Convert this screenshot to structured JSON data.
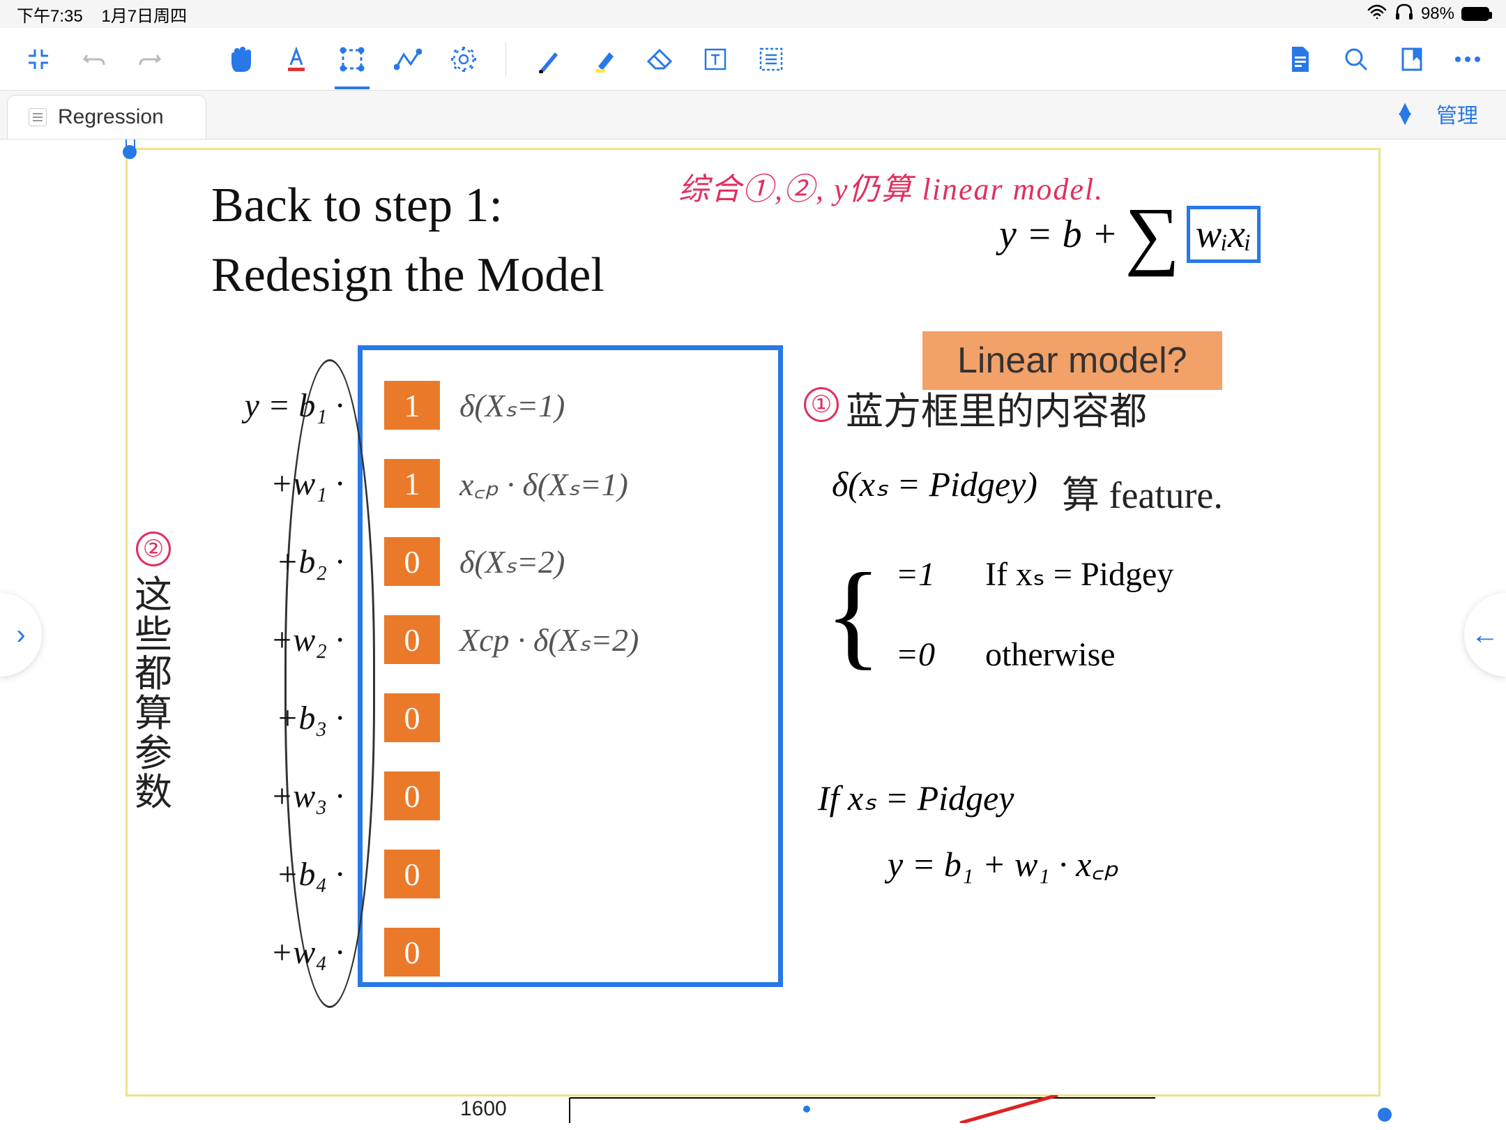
{
  "status": {
    "time": "下午7:35",
    "date": "1月7日周四",
    "battery": "98%"
  },
  "tab": {
    "title": "Regression",
    "manage": "管理"
  },
  "slide": {
    "title1": "Back to step 1:",
    "title2": "Redesign the Model",
    "topFormula_y": "y = b +",
    "topFormula_wx": "wᵢxᵢ",
    "linearBadge": "Linear model?",
    "eq_start": "y =",
    "rows": [
      {
        "label": "b₁ ·",
        "num": "1",
        "note": "δ(Xₛ=1)"
      },
      {
        "label": "+w₁ ·",
        "num": "1",
        "note": "x꜀ₚ · δ(Xₛ=1)"
      },
      {
        "label": "+b₂ ·",
        "num": "0",
        "note": "δ(Xₛ=2)"
      },
      {
        "label": "+w₂ ·",
        "num": "0",
        "note": "Xcp · δ(Xₛ=2)"
      },
      {
        "label": "+b₃ ·",
        "num": "0",
        "note": ""
      },
      {
        "label": "+w₃ ·",
        "num": "0",
        "note": ""
      },
      {
        "label": "+b₄ ·",
        "num": "0",
        "note": ""
      },
      {
        "label": "+w₄ ·",
        "num": "0",
        "note": ""
      }
    ],
    "delta": "δ(xₛ = Pidgey)",
    "brace_r1a": "=1",
    "brace_r1b": "If xₛ = Pidgey",
    "brace_r2a": "=0",
    "brace_r2b": "otherwise",
    "if_line": "If xₛ = Pidgey",
    "if_formula": "y = b₁ + w₁ · x꜀ₚ",
    "bottom_tick": "1600"
  },
  "annot": {
    "redTop": "综合①,②, y仍算 linear model.",
    "leftNum": "②",
    "leftText": "这些都算参数",
    "r1Num": "①",
    "r1": "蓝方框里的内容都",
    "r2": "算 feature."
  }
}
